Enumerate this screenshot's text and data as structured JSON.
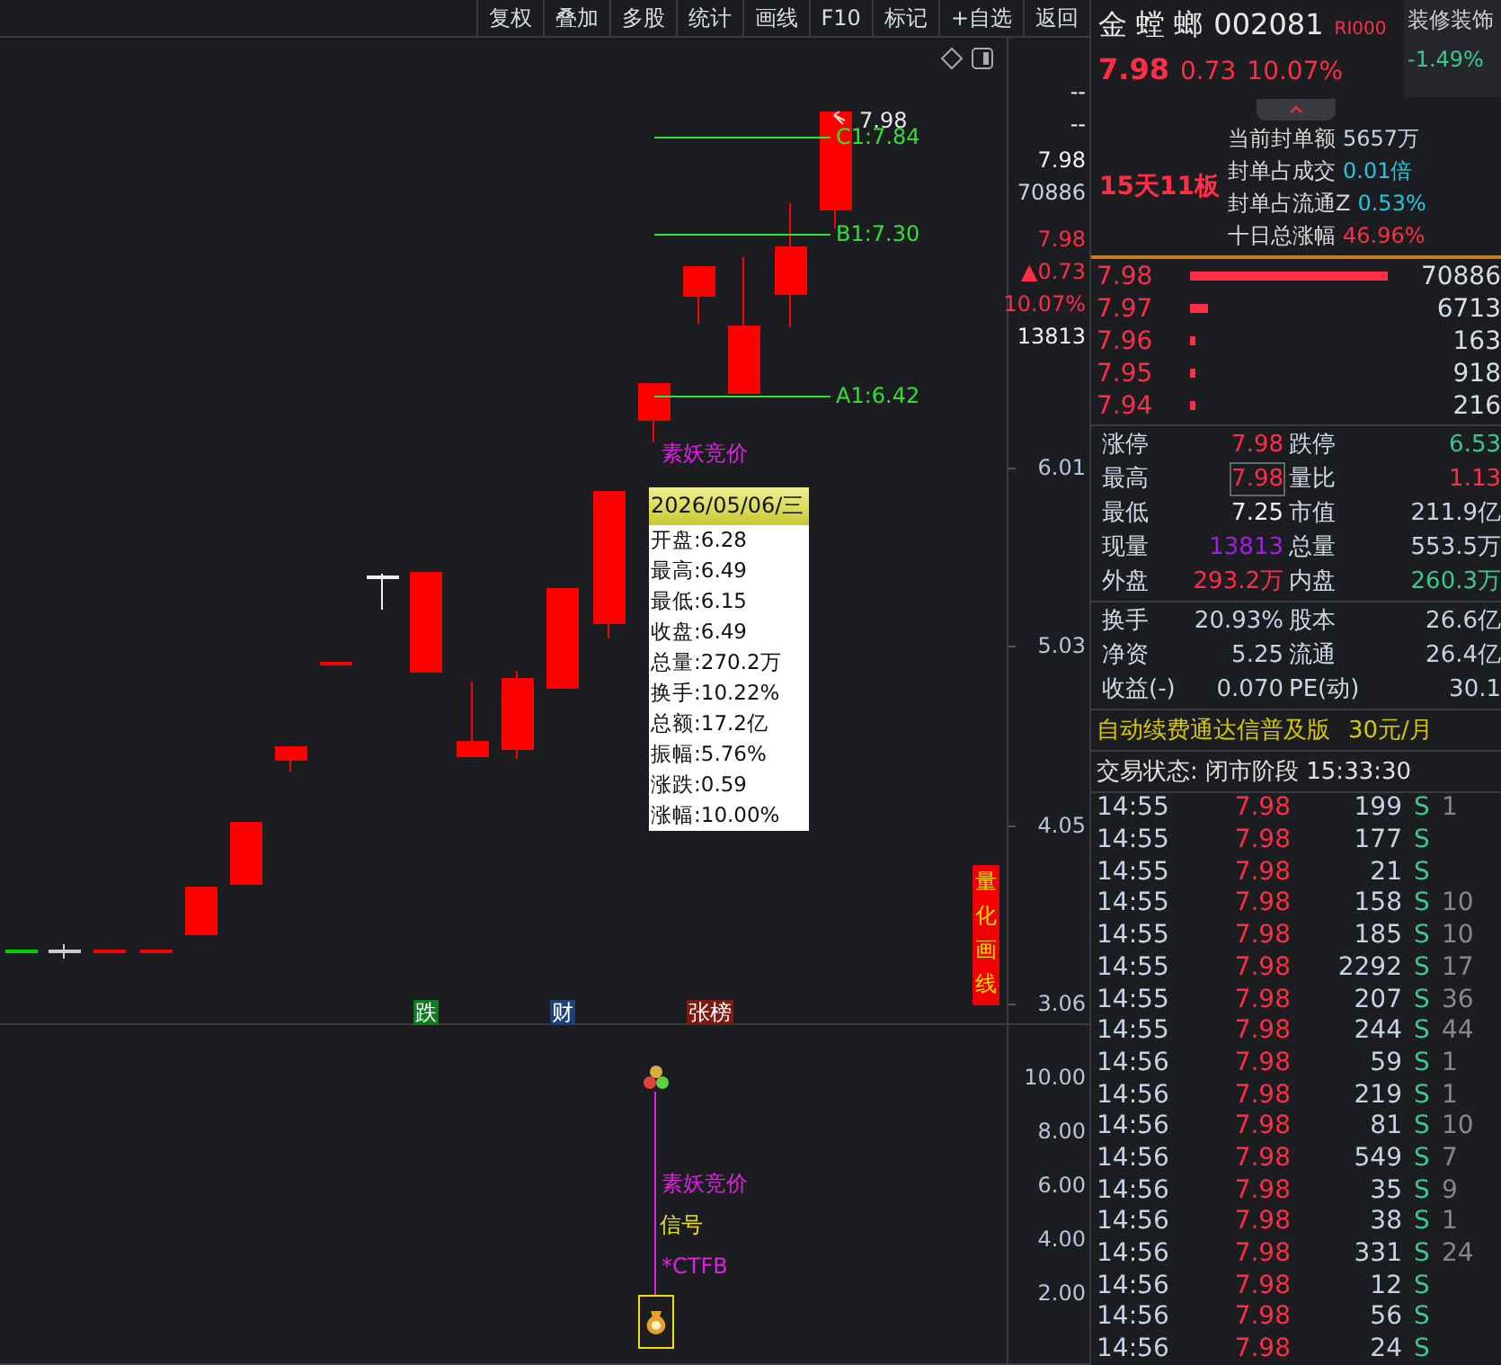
{
  "toolbar": {
    "buttons": [
      "复权",
      "叠加",
      "多股",
      "统计",
      "画线",
      "F10",
      "标记",
      "+自选",
      "返回"
    ]
  },
  "price_chart": {
    "axis_labels": [
      {
        "text": "--",
        "kind": "plain"
      },
      {
        "text": "--",
        "kind": "plain"
      },
      {
        "text": "7.98",
        "kind": "plain"
      },
      {
        "text": "70886",
        "kind": "light"
      },
      {
        "text": "7.98",
        "kind": "up"
      },
      {
        "text": "▲0.73",
        "kind": "up"
      },
      {
        "text": "10.07%",
        "kind": "up"
      },
      {
        "text": "13813",
        "kind": "plain"
      },
      {
        "text": "6.01",
        "kind": "tick"
      },
      {
        "text": "5.03",
        "kind": "tick"
      },
      {
        "text": "4.05",
        "kind": "tick"
      },
      {
        "text": "3.06",
        "kind": "tick"
      }
    ],
    "last_price": "7.98",
    "levels": [
      {
        "label": "C1:7.84"
      },
      {
        "label": "B1:7.30"
      },
      {
        "label": "A1:6.42"
      }
    ],
    "signal_label": "素妖竞价",
    "tooltip": {
      "title": "2026/05/06/三",
      "rows": [
        "开盘:6.28",
        "最高:6.49",
        "最低:6.15",
        "收盘:6.49",
        "总量:270.2万",
        "换手:10.22%",
        "总额:17.2亿",
        "振幅:5.76%",
        "涨跌:0.59",
        "涨幅:10.00%"
      ]
    },
    "markers": [
      {
        "text": "跌",
        "color": "#0f7a1e"
      },
      {
        "text": "财",
        "color": "#1d3f7a"
      },
      {
        "text": "张榜",
        "color": "#7a1a10"
      }
    ],
    "side_tag": "量化画线"
  },
  "indicator_pane": {
    "axis_labels": [
      "10.00",
      "8.00",
      "6.00",
      "4.00",
      "2.00"
    ],
    "texts": [
      {
        "text": "素妖竞价",
        "color": "#e020e0"
      },
      {
        "text": "信号",
        "color": "#e8e020"
      },
      {
        "text": "*CTFB",
        "color": "#e020e0"
      }
    ]
  },
  "quote": {
    "name": "金 螳 螂",
    "code": "002081",
    "tag": "RI000",
    "sector": "装修装饰",
    "sector_change": "-1.49%",
    "price": "7.98",
    "change": "0.73",
    "change_pct": "10.07%",
    "board_count": "15天11板",
    "seal_info": [
      {
        "label": "当前封单额",
        "value": "5657万"
      },
      {
        "label": "封单占成交",
        "value": "0.01倍"
      },
      {
        "label": "封单占流通Z",
        "value": "0.53%"
      },
      {
        "label": "十日总涨幅",
        "value": "46.96%"
      }
    ],
    "bids": [
      {
        "price": "7.98",
        "volume": "70886"
      },
      {
        "price": "7.97",
        "volume": "6713"
      },
      {
        "price": "7.96",
        "volume": "163"
      },
      {
        "price": "7.95",
        "volume": "918"
      },
      {
        "price": "7.94",
        "volume": "216"
      }
    ],
    "stats": [
      {
        "label": "涨停",
        "value": "7.98",
        "highlighted": false,
        "label2": "跌停",
        "value2": "6.53"
      },
      {
        "label": "最高",
        "value": "7.98",
        "highlighted": true,
        "label2": "量比",
        "value2": "1.13"
      },
      {
        "label": "最低",
        "value": "7.25",
        "highlighted": false,
        "label2": "市值",
        "value2": "211.9亿"
      },
      {
        "label": "现量",
        "value": "13813",
        "highlighted": false,
        "label2": "总量",
        "value2": "553.5万"
      },
      {
        "label": "外盘",
        "value": "293.2万",
        "highlighted": false,
        "label2": "内盘",
        "value2": "260.3万"
      }
    ],
    "fundamentals": [
      {
        "label": "换手",
        "value": "20.93%",
        "label2": "股本",
        "value2": "26.6亿"
      },
      {
        "label": "净资",
        "value": "5.25",
        "label2": "流通",
        "value2": "26.4亿"
      },
      {
        "label": "收益(-)",
        "value": "0.070",
        "label2": "PE(动)",
        "value2": "30.1"
      }
    ],
    "promo": "自动续费通达信普及版",
    "promo_price": "30元/月",
    "status": "交易状态: 闭市阶段 15:33:30",
    "trades": [
      {
        "time": "14:55",
        "price": "7.98",
        "volume": "199",
        "side": "S",
        "column_5": "1"
      },
      {
        "time": "14:55",
        "price": "7.98",
        "volume": "177",
        "side": "S"
      },
      {
        "time": "14:55",
        "price": "7.98",
        "volume": "21",
        "side": "S"
      },
      {
        "time": "14:55",
        "price": "7.98",
        "volume": "158",
        "side": "S",
        "column_5": "10"
      },
      {
        "time": "14:55",
        "price": "7.98",
        "volume": "185",
        "side": "S",
        "column_5": "10"
      },
      {
        "time": "14:55",
        "price": "7.98",
        "volume": "2292",
        "side": "S",
        "column_5": "17"
      },
      {
        "time": "14:55",
        "price": "7.98",
        "volume": "207",
        "side": "S",
        "column_5": "36"
      },
      {
        "time": "14:55",
        "price": "7.98",
        "volume": "244",
        "side": "S",
        "column_5": "44"
      },
      {
        "time": "14:56",
        "price": "7.98",
        "volume": "59",
        "side": "S",
        "column_5": "1"
      },
      {
        "time": "14:56",
        "price": "7.98",
        "volume": "219",
        "side": "S",
        "column_5": "1"
      },
      {
        "time": "14:56",
        "price": "7.98",
        "volume": "81",
        "side": "S",
        "column_5": "10"
      },
      {
        "time": "14:56",
        "price": "7.98",
        "volume": "549",
        "side": "S",
        "column_5": "7"
      },
      {
        "time": "14:56",
        "price": "7.98",
        "volume": "35",
        "side": "S",
        "column_5": "9"
      },
      {
        "time": "14:56",
        "price": "7.98",
        "volume": "38",
        "side": "S",
        "column_5": "1"
      },
      {
        "time": "14:56",
        "price": "7.98",
        "volume": "331",
        "side": "S",
        "column_5": "24"
      },
      {
        "time": "14:56",
        "price": "7.98",
        "volume": "12",
        "side": "S"
      },
      {
        "time": "14:56",
        "price": "7.98",
        "volume": "56",
        "side": "S"
      },
      {
        "time": "14:56",
        "price": "7.98",
        "volume": "24",
        "side": "S"
      }
    ]
  }
}
